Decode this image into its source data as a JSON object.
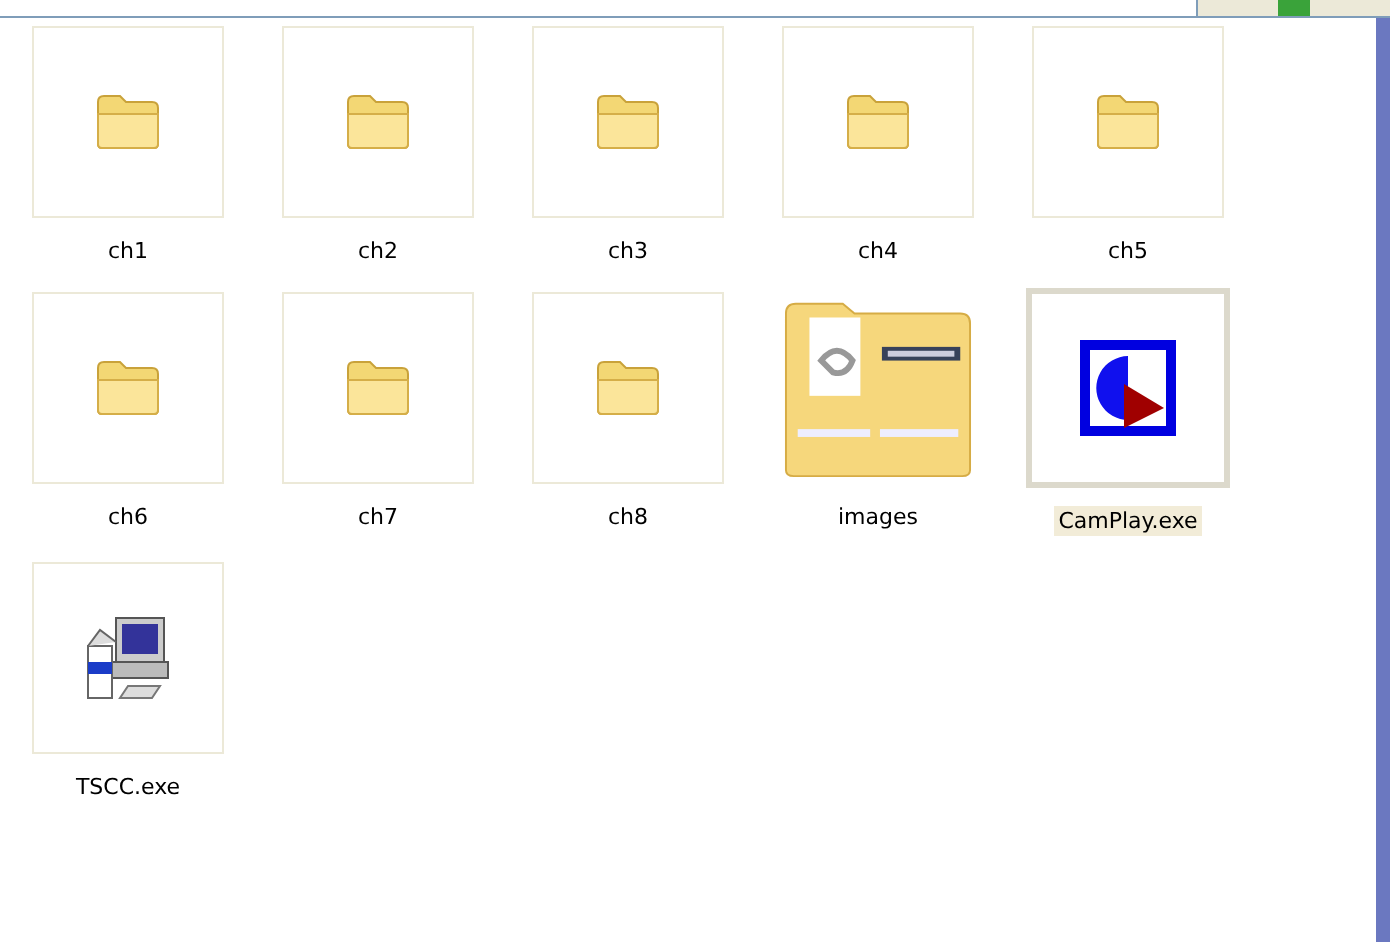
{
  "items": [
    {
      "label": "ch1",
      "kind": "folder",
      "selected": false
    },
    {
      "label": "ch2",
      "kind": "folder",
      "selected": false
    },
    {
      "label": "ch3",
      "kind": "folder",
      "selected": false
    },
    {
      "label": "ch4",
      "kind": "folder",
      "selected": false
    },
    {
      "label": "ch5",
      "kind": "folder",
      "selected": false
    },
    {
      "label": "ch6",
      "kind": "folder",
      "selected": false
    },
    {
      "label": "ch7",
      "kind": "folder",
      "selected": false
    },
    {
      "label": "ch8",
      "kind": "folder",
      "selected": false
    },
    {
      "label": "images",
      "kind": "image-folder",
      "selected": false
    },
    {
      "label": "CamPlay.exe",
      "kind": "player-app",
      "selected": true
    },
    {
      "label": "TSCC.exe",
      "kind": "installer-app",
      "selected": false
    }
  ]
}
